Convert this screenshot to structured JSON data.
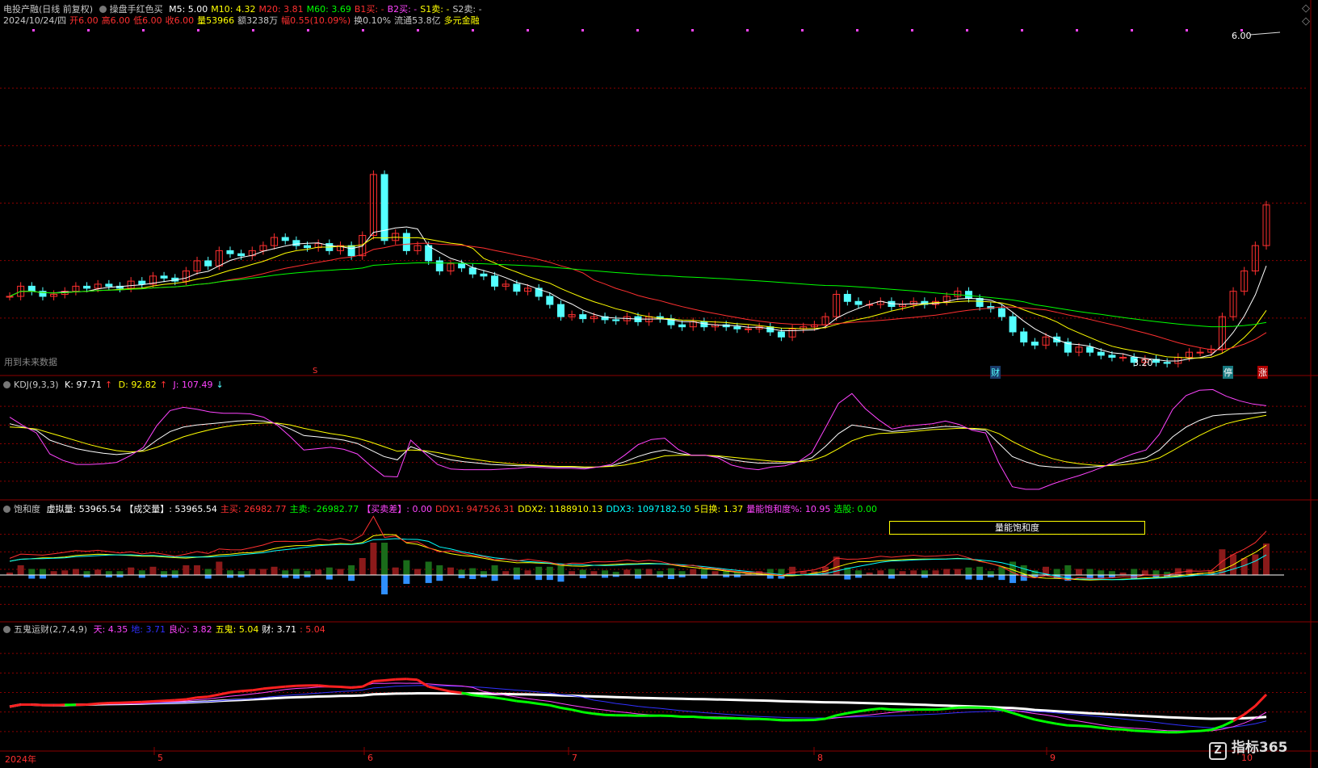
{
  "main": {
    "stock_name": "电投产融(日线 前复权)",
    "indicator": "操盘手红色买",
    "ma": [
      {
        "label": "M5: 5.00",
        "color": "#ffffff"
      },
      {
        "label": "M10: 4.32",
        "color": "#ffff00"
      },
      {
        "label": "M20: 3.81",
        "color": "#ff3030"
      },
      {
        "label": "M60: 3.69",
        "color": "#00ff00"
      },
      {
        "label": "B1买: -",
        "color": "#ff3030"
      },
      {
        "label": "B2买: -",
        "color": "#ff44ff"
      },
      {
        "label": "S1卖: -",
        "color": "#ffff00"
      },
      {
        "label": "S2卖: -",
        "color": "#c8c8c8"
      }
    ],
    "info": [
      {
        "text": "2024/10/24/四",
        "color": "#c8c8c8"
      },
      {
        "text": "开6.00",
        "color": "#ff3030"
      },
      {
        "text": "高6.00",
        "color": "#ff3030"
      },
      {
        "text": "低6.00",
        "color": "#ff3030"
      },
      {
        "text": "收6.00",
        "color": "#ff3030"
      },
      {
        "text": "量53966",
        "color": "#ffff00"
      },
      {
        "text": "额3238万",
        "color": "#c8c8c8"
      },
      {
        "text": "幅0.55(10.09%)",
        "color": "#ff3030"
      },
      {
        "text": "换0.10%",
        "color": "#c8c8c8"
      },
      {
        "text": "流通53.8亿",
        "color": "#c8c8c8"
      },
      {
        "text": "多元金融",
        "color": "#ffff00"
      }
    ],
    "price_tag": "6.00",
    "low_tag": "3.20",
    "future_note": "用到未来数据",
    "marks": {
      "s": "S",
      "cai": "财",
      "ting": "停",
      "zhang": "涨"
    }
  },
  "kdj": {
    "title": "KDJ(9,3,3)",
    "k": "K: 97.71",
    "d": "D: 92.82",
    "j": "J: 107.49"
  },
  "sat": {
    "title": "饱和度",
    "items": [
      {
        "text": "虚拟量: 53965.54",
        "color": "#ffffff"
      },
      {
        "text": "【成交量】: 53965.54",
        "color": "#ffffff"
      },
      {
        "text": "主买: 26982.77",
        "color": "#ff3030"
      },
      {
        "text": "主卖: -26982.77",
        "color": "#00ff00"
      },
      {
        "text": "【买卖差】: 0.00",
        "color": "#ff44ff"
      },
      {
        "text": "DDX1: 947526.31",
        "color": "#ff3030"
      },
      {
        "text": "DDX2: 1188910.13",
        "color": "#ffff00"
      },
      {
        "text": "DDX3: 1097182.50",
        "color": "#00ffff"
      },
      {
        "text": "5日换: 1.37",
        "color": "#ffff00"
      },
      {
        "text": "量能饱和度%: 10.95",
        "color": "#ff44ff"
      },
      {
        "text": "选股: 0.00",
        "color": "#00ff00"
      }
    ],
    "box_label": "量能饱和度"
  },
  "wugui": {
    "title": "五鬼运财(2,7,4,9)",
    "items": [
      {
        "text": "天: 4.35",
        "color": "#ff44ff"
      },
      {
        "text": "地: 3.71",
        "color": "#3030ff"
      },
      {
        "text": "良心: 3.82",
        "color": "#ff44ff"
      },
      {
        "text": "五鬼: 5.04",
        "color": "#ffff00"
      },
      {
        "text": "财: 3.71",
        "color": "#ffffff"
      },
      {
        "text": ": 5.04",
        "color": "#ff3030"
      }
    ]
  },
  "xaxis": {
    "year": "2024年",
    "months": [
      "5",
      "6",
      "7",
      "8",
      "9",
      "10"
    ]
  },
  "watermark": "指标365",
  "colors": {
    "up": "#ff3030",
    "down": "#54ffff",
    "bg": "#000000",
    "grid": "#8b0000"
  },
  "chart_data": [
    {
      "type": "candlestick",
      "title": "电投产融(日线 前复权)",
      "series": [
        {
          "name": "close",
          "values": [
            3.5,
            3.6,
            3.55,
            3.5,
            3.52,
            3.55,
            3.6,
            3.58,
            3.62,
            3.6,
            3.58,
            3.65,
            3.62,
            3.7,
            3.68,
            3.65,
            3.75,
            3.85,
            3.8,
            3.95,
            3.92,
            3.9,
            3.95,
            4.0,
            4.08,
            4.05,
            4.0,
            3.98,
            4.02,
            3.95,
            4.0,
            3.9,
            4.1,
            4.7,
            4.05,
            4.12,
            3.95,
            4.0,
            3.85,
            3.75,
            3.82,
            3.78,
            3.72,
            3.7,
            3.6,
            3.62,
            3.55,
            3.58,
            3.5,
            3.42,
            3.3,
            3.32,
            3.28,
            3.3,
            3.27,
            3.26,
            3.3,
            3.25,
            3.3,
            3.28,
            3.22,
            3.2,
            3.25,
            3.2,
            3.22,
            3.2,
            3.18,
            3.18,
            3.2,
            3.15,
            3.1,
            3.18,
            3.2,
            3.22,
            3.3,
            3.52,
            3.45,
            3.42,
            3.42,
            3.45,
            3.4,
            3.42,
            3.45,
            3.42,
            3.45,
            3.5,
            3.55,
            3.48,
            3.4,
            3.38,
            3.3,
            3.15,
            3.05,
            3.02,
            3.1,
            3.05,
            2.95,
            3.0,
            2.95,
            2.92,
            2.9,
            2.9,
            2.85,
            2.88,
            2.85,
            2.84,
            2.9,
            2.95,
            2.95,
            2.98,
            3.3,
            3.55,
            3.75,
            4.0,
            4.4
          ]
        },
        {
          "name": "M5"
        },
        {
          "name": "M10"
        },
        {
          "name": "M20"
        },
        {
          "name": "M60"
        }
      ],
      "ylim": [
        2.8,
        6.1
      ]
    },
    {
      "type": "line",
      "title": "KDJ(9,3,3)",
      "series": [
        {
          "name": "K",
          "values": [
            80,
            75,
            70,
            55,
            48,
            42,
            38,
            35,
            33,
            35,
            40,
            55,
            68,
            75,
            78,
            80,
            82,
            84,
            85,
            84,
            80,
            72,
            62,
            60,
            58,
            55,
            50,
            40,
            30,
            25,
            45,
            38,
            30,
            25,
            22,
            20,
            18,
            17,
            16,
            16,
            15,
            14,
            14,
            13,
            14,
            16,
            22,
            30,
            36,
            40,
            35,
            32,
            32,
            30,
            25,
            22,
            20,
            20,
            20,
            22,
            28,
            45,
            65,
            78,
            75,
            72,
            68,
            70,
            72,
            74,
            76,
            75,
            72,
            70,
            50,
            30,
            22,
            16,
            14,
            13,
            13,
            14,
            16,
            20,
            24,
            28,
            40,
            60,
            75,
            85,
            92,
            94,
            95,
            96,
            97.71
          ]
        },
        {
          "name": "D",
          "values": [
            75,
            74,
            72,
            66,
            60,
            54,
            48,
            43,
            39,
            37,
            38,
            44,
            52,
            60,
            66,
            71,
            75,
            78,
            80,
            81,
            81,
            78,
            73,
            69,
            65,
            62,
            58,
            52,
            45,
            38,
            40,
            39,
            36,
            32,
            28,
            25,
            22,
            20,
            18,
            17,
            16,
            15,
            15,
            14,
            14,
            15,
            17,
            21,
            26,
            31,
            32,
            32,
            32,
            31,
            29,
            27,
            25,
            23,
            22,
            22,
            24,
            31,
            42,
            54,
            61,
            65,
            66,
            67,
            69,
            71,
            72,
            73,
            73,
            72,
            65,
            53,
            43,
            34,
            27,
            22,
            19,
            17,
            16,
            17,
            19,
            22,
            28,
            39,
            51,
            62,
            72,
            80,
            85,
            89,
            92.82
          ]
        },
        {
          "name": "J",
          "values": [
            90,
            77,
            66,
            34,
            24,
            18,
            18,
            19,
            21,
            31,
            44,
            77,
            100,
            105,
            102,
            98,
            96,
            96,
            95,
            90,
            78,
            60,
            40,
            42,
            44,
            41,
            34,
            16,
            0,
            -1,
            55,
            36,
            18,
            11,
            10,
            10,
            10,
            11,
            12,
            14,
            13,
            12,
            12,
            11,
            14,
            18,
            32,
            48,
            56,
            58,
            41,
            32,
            32,
            28,
            17,
            12,
            10,
            14,
            16,
            22,
            36,
            73,
            111,
            126,
            103,
            86,
            72,
            76,
            78,
            80,
            84,
            79,
            70,
            66,
            20,
            -16,
            -20,
            -20,
            -12,
            -5,
            1,
            8,
            16,
            26,
            34,
            40,
            64,
            102,
            123,
            131,
            132,
            122,
            115,
            110,
            107.49
          ]
        }
      ]
    },
    {
      "type": "bar",
      "title": "饱和度",
      "series": [
        {
          "name": "虚拟量",
          "values": [
            53965.54
          ]
        },
        {
          "name": "主买",
          "values": [
            26982.77
          ]
        },
        {
          "name": "主卖",
          "values": [
            -26982.77
          ]
        }
      ]
    },
    {
      "type": "line",
      "title": "五鬼运财(2,7,4,9)",
      "series": [
        {
          "name": "天",
          "values": [
            4.35
          ]
        },
        {
          "name": "地",
          "values": [
            3.71
          ]
        },
        {
          "name": "良心",
          "values": [
            3.82
          ]
        },
        {
          "name": "五鬼",
          "values": [
            5.04
          ]
        },
        {
          "name": "财",
          "values": [
            3.71
          ]
        }
      ]
    }
  ]
}
